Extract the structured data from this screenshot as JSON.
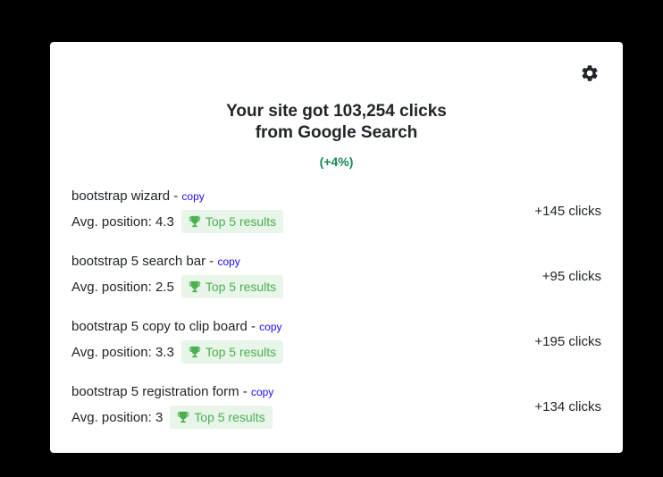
{
  "summary": {
    "line1": "Your site got 103,254 clicks",
    "line2": "from Google Search",
    "change": "(+4%)"
  },
  "icons": {
    "settings": "gear-icon",
    "badge": "trophy-icon"
  },
  "colors": {
    "positive": "#198754",
    "badge_bg": "#e8f5e9",
    "badge_text": "#4caf50",
    "link": "#1a0dff"
  },
  "rows": [
    {
      "keyword": "bootstrap wizard",
      "copy": "copy",
      "position": "Avg. position: 4.3",
      "badge": "Top 5 results",
      "clicks": "+145 clicks"
    },
    {
      "keyword": "bootstrap 5 search bar",
      "copy": "copy",
      "position": "Avg. position: 2.5",
      "badge": "Top 5 results",
      "clicks": "+95 clicks"
    },
    {
      "keyword": "bootstrap 5 copy to clip board",
      "copy": "copy",
      "position": "Avg. position: 3.3",
      "badge": "Top 5 results",
      "clicks": "+195 clicks"
    },
    {
      "keyword": "bootstrap 5 registration form",
      "copy": "copy",
      "position": "Avg. position: 3",
      "badge": "Top 5 results",
      "clicks": "+134 clicks"
    }
  ]
}
